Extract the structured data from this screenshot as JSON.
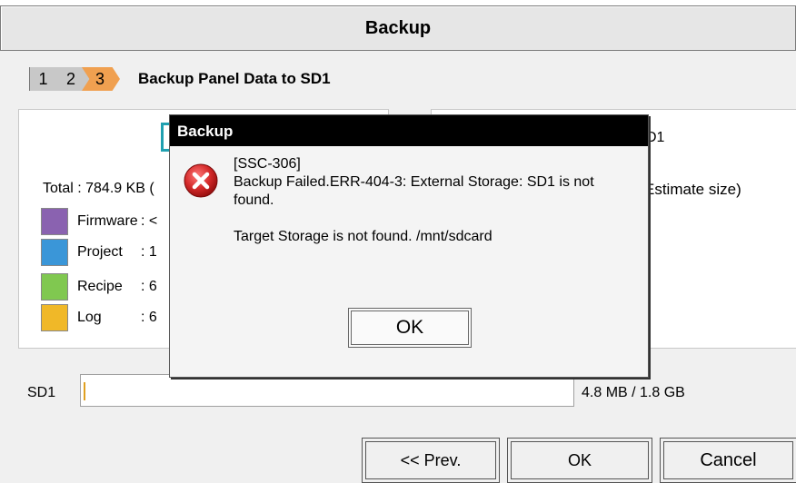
{
  "window": {
    "title": "Backup"
  },
  "steps": {
    "items": [
      "1",
      "2",
      "3"
    ],
    "current_title": "Backup Panel Data to SD1"
  },
  "left_panel": {
    "total": "Total : 784.9 KB (",
    "legend": [
      {
        "label": "Firmware",
        "value": ": <",
        "color": "#8a62b0"
      },
      {
        "label": "Project",
        "value": ": 1",
        "color": "#3a96d8"
      },
      {
        "label": "Recipe",
        "value": ": 6",
        "color": "#80c850"
      },
      {
        "label": "Log",
        "value": ": 6",
        "color": "#f0b828"
      }
    ]
  },
  "right_panel": {
    "title": "D1",
    "estimate": "Estimate size)"
  },
  "storage": {
    "label": "SD1",
    "usage": "4.8 MB / 1.8 GB",
    "used_fraction": 0.0026
  },
  "buttons": {
    "prev": "<< Prev.",
    "ok": "OK",
    "cancel": "Cancel"
  },
  "dialog": {
    "title": "Backup",
    "icon": "error-icon",
    "code": "[SSC-306]",
    "message": "Backup Failed.ERR-404-3: External Storage: SD1 is not found.",
    "detail": "Target Storage is not found. /mnt/sdcard",
    "ok_label": "OK"
  },
  "colors": {
    "accent_step": "#f0a050",
    "error_red": "#d42a2a",
    "dialog_title_bg": "#000000"
  }
}
